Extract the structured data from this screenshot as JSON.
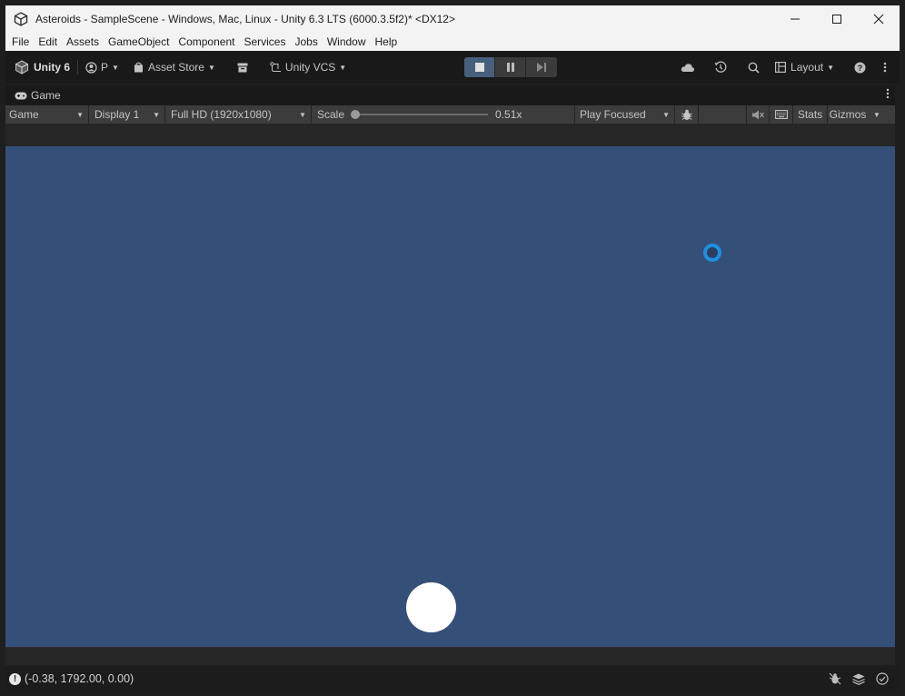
{
  "window": {
    "title": "Asteroids - SampleScene - Windows, Mac, Linux - Unity 6.3 LTS (6000.3.5f2)* <DX12>",
    "minimize": "—",
    "maximize": "☐",
    "close": "✕"
  },
  "menu": [
    "File",
    "Edit",
    "Assets",
    "GameObject",
    "Component",
    "Services",
    "Jobs",
    "Window",
    "Help"
  ],
  "toolbar": {
    "unity_label": "Unity 6",
    "account_label": "P",
    "asset_store_label": "Asset Store",
    "vcs_label": "Unity VCS",
    "layout_label": "Layout",
    "play_active": "stop"
  },
  "game_tab": {
    "tab_label": "Game",
    "view_dropdown": "Game",
    "display_dropdown": "Display 1",
    "resolution_dropdown": "Full HD (1920x1080)",
    "scale_label": "Scale",
    "scale_value": "0.51x",
    "scale_fraction": 0.0,
    "play_mode_dropdown": "Play Focused",
    "stats_label": "Stats",
    "gizmos_label": "Gizmos"
  },
  "viewport": {
    "background_color": "#344f78",
    "ball_color": "#ffffff",
    "loader_color": "#1e8fe0"
  },
  "status": {
    "message": "(-0.38, 1792.00, 0.00)"
  }
}
